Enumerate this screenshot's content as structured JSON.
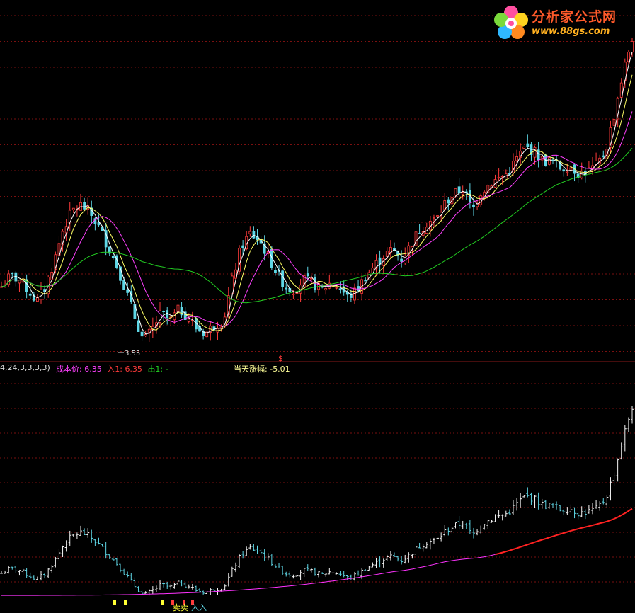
{
  "logo": {
    "icon": "flower-icon",
    "title": "分析家公式网",
    "url": "www.88gs.com"
  },
  "info_bar": {
    "params": "4,24,3,3,3,3)",
    "cost_label": "成本价:",
    "cost_value": "6.35",
    "in_label": "入1:",
    "in_value": "6.35",
    "out_label": "出1:",
    "out_value": "-",
    "change_label": "当天涨幅:",
    "change_value": "-5.01",
    "marker": "$"
  },
  "chart_data": [
    {
      "type": "candlestick",
      "panel": "upper",
      "annotations": [
        {
          "text": "3.55",
          "kind": "low-price-marker"
        }
      ],
      "grid": true,
      "colors": {
        "up": "#ff3b3b",
        "down": "#5fd7e6",
        "ma_fast": "#ffffff",
        "ma_mid": "#ffff66",
        "ma_slow": "#ff40ff",
        "ma_long": "#22cc22",
        "grid": "#7a1010"
      },
      "series": [
        {
          "kind": "close",
          "values": [
            4.3,
            4.45,
            4.4,
            4.25,
            4.1,
            4.3,
            4.7,
            5.2,
            5.5,
            5.6,
            5.45,
            5.2,
            4.9,
            4.6,
            4.25,
            3.9,
            3.6,
            3.75,
            3.95,
            3.85,
            4.0,
            3.9,
            3.75,
            3.7,
            3.8,
            3.85,
            4.4,
            4.9,
            5.1,
            5.0,
            4.75,
            4.5,
            4.3,
            4.25,
            4.4,
            4.35,
            4.25,
            4.35,
            4.3,
            4.15,
            4.25,
            4.45,
            4.6,
            4.75,
            4.85,
            4.7,
            4.9,
            5.15,
            5.3,
            5.35,
            5.65,
            5.8,
            5.9,
            5.5,
            5.85,
            6.0,
            6.1,
            6.2,
            6.5,
            6.75,
            6.65,
            6.45,
            6.45,
            6.3,
            6.35,
            6.2,
            6.25,
            6.35,
            6.65,
            7.5,
            8.6,
            9.6
          ]
        },
        {
          "kind": "ma",
          "name": "",
          "period": 5
        },
        {
          "kind": "ma",
          "name": "",
          "period": 10
        },
        {
          "kind": "ma",
          "name": "",
          "period": 24
        }
      ]
    },
    {
      "type": "bar",
      "panel": "lower",
      "signals": [
        {
          "text": "卖卖",
          "color": "#ffff33"
        },
        {
          "text": "入入",
          "color": "#5fd7e6"
        }
      ],
      "cost_line_color": "#ff33ff",
      "cost_line_high_color": "#ff2222"
    }
  ]
}
